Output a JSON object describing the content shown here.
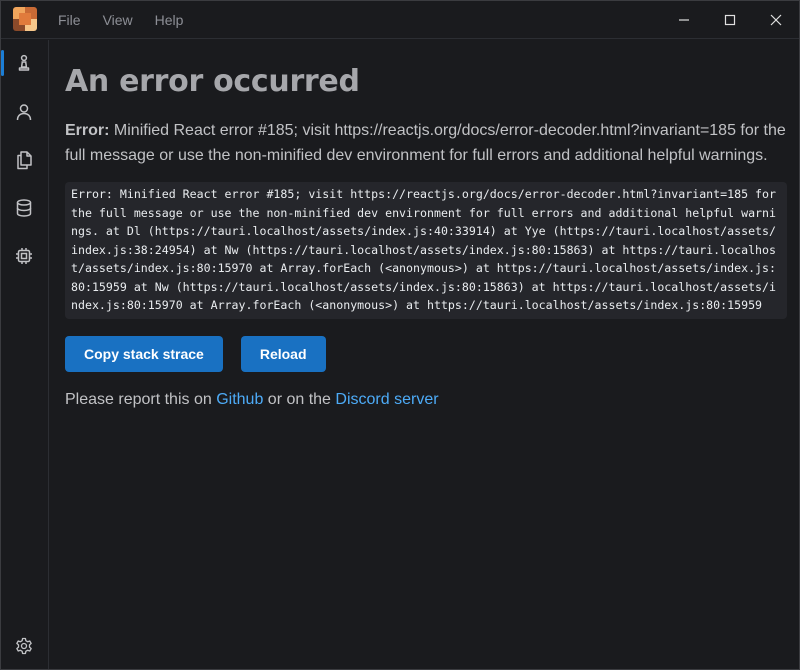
{
  "menu": {
    "items": [
      "File",
      "View",
      "Help"
    ]
  },
  "window_controls": {
    "minimize": "minimize-icon",
    "maximize": "maximize-icon",
    "close": "close-icon"
  },
  "sidebar": {
    "items": [
      {
        "icon": "chess-pawn-icon",
        "active": true
      },
      {
        "icon": "user-icon",
        "active": false
      },
      {
        "icon": "copy-files-icon",
        "active": false
      },
      {
        "icon": "database-icon",
        "active": false
      },
      {
        "icon": "cpu-chip-icon",
        "active": false
      }
    ],
    "bottom_icon": "settings-gear-icon"
  },
  "error": {
    "heading": "An error occurred",
    "label": "Error:",
    "message": "Minified React error #185; visit https://reactjs.org/docs/error-decoder.html?invariant=185 for the full message or use the non-minified dev environment for full errors and additional helpful warnings.",
    "stack": "Error: Minified React error #185; visit https://reactjs.org/docs/error-decoder.html?invariant=185 for the full message or use the non-minified dev environment for full errors and additional helpful warnings. at Dl (https://tauri.localhost/assets/index.js:40:33914) at Yye (https://tauri.localhost/assets/index.js:38:24954) at Nw (https://tauri.localhost/assets/index.js:80:15863) at https://tauri.localhost/assets/index.js:80:15970 at Array.forEach (<anonymous>) at https://tauri.localhost/assets/index.js:80:15959 at Nw (https://tauri.localhost/assets/index.js:80:15863) at https://tauri.localhost/assets/index.js:80:15970 at Array.forEach (<anonymous>) at https://tauri.localhost/assets/index.js:80:15959"
  },
  "actions": {
    "copy_label": "Copy stack strace",
    "reload_label": "Reload"
  },
  "report": {
    "prefix": "Please report this on",
    "github": "Github",
    "middle": "or on the",
    "discord": "Discord server"
  },
  "colors": {
    "background": "#1a1b1e",
    "accent": "#1971c2",
    "link": "#4dabf7",
    "code_bg": "#25262b"
  }
}
